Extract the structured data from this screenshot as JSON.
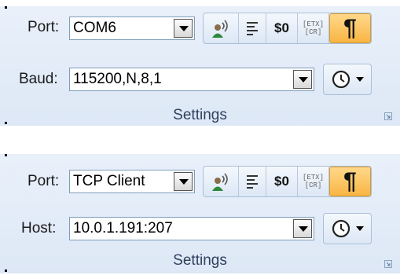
{
  "panel1": {
    "port_label": "Port:",
    "port_value": "COM6",
    "second_label": "Baud:",
    "second_value": "115200,N,8,1",
    "group_label": "Settings"
  },
  "panel2": {
    "port_label": "Port:",
    "port_value": "TCP Client",
    "second_label": "Host:",
    "second_value": "10.0.1.191:207",
    "group_label": "Settings"
  },
  "toolbar": {
    "dollar_label": "$0",
    "etx_label": "[ETX]",
    "cr_label": "[CR]",
    "pilcrow_label": "¶"
  },
  "icons": [
    "transmit-icon",
    "align-left-icon",
    "null-char-icon",
    "etx-cr-icon",
    "pilcrow-icon",
    "clock-icon",
    "chevron-down-icon",
    "dialog-launcher-icon"
  ],
  "colors": {
    "panel_bg": "#dde8f6",
    "active_button": "#f9b544",
    "border": "#a9bfd6"
  }
}
